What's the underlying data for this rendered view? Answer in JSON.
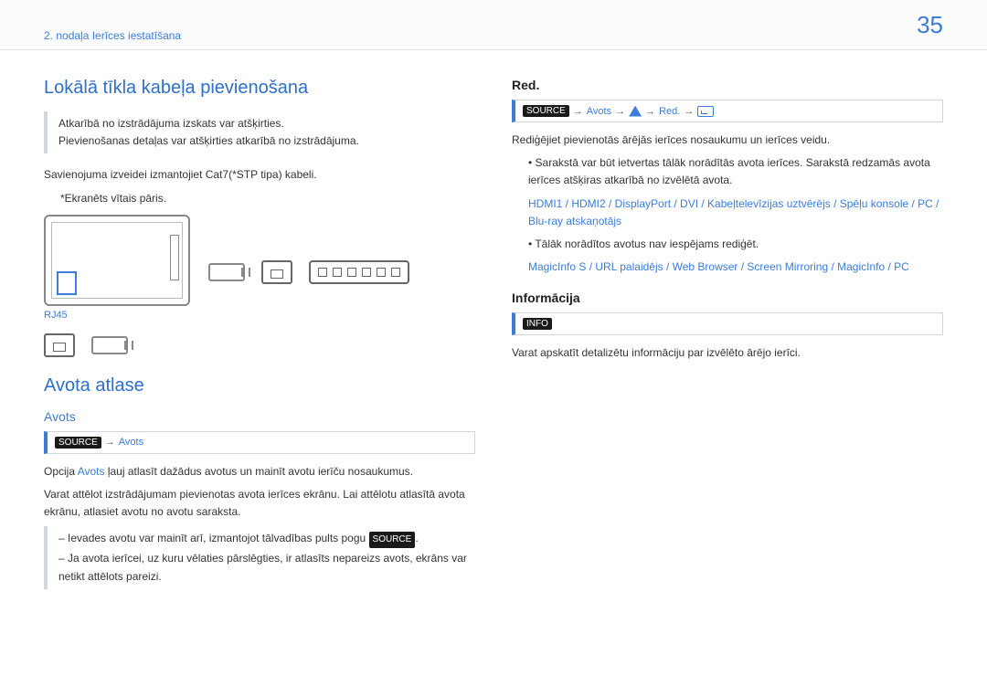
{
  "header": {
    "chapter": "2. nodaļa Ierīces iestatīšana",
    "page_number": "35"
  },
  "left": {
    "h1_cable": "Lokālā tīkla kabeļa pievienošana",
    "note1_line1": "Atkarībā no izstrādājuma izskats var atšķirties.",
    "note1_line2": "Pievienošanas detaļas var atšķirties atkarībā no izstrādājuma.",
    "line_conn": "Savienojuma izveidei izmantojiet Cat7(*STP tipa) kabeli.",
    "line_ekr": "*Ekranēts vītais pāris.",
    "rj45_label": "RJ45",
    "h1_source_sel": "Avota atlase",
    "h2_source": "Avots",
    "path_source": {
      "badge": "SOURCE",
      "text": "Avots"
    },
    "p_opcija_pre": "Opcija ",
    "p_opcija_mid": "Avots",
    "p_opcija_post": " ļauj atlasīt dažādus avotus un mainīt avotu ierīču nosaukumus.",
    "p_varat": "Varat attēlot izstrādājumam pievienotas avota ierīces ekrānu. Lai attēlotu atlasītā avota ekrānu, atlasiet avotu no avotu saraksta.",
    "note2_line1_pre": "Ievades avotu var mainīt arī, izmantojot tālvadības pults pogu ",
    "note2_line1_badge": "SOURCE",
    "note2_line1_post": ".",
    "note2_line2": "Ja avota ierīcei, uz kuru vēlaties pārslēgties, ir atlasīts nepareizs avots, ekrāns var netikt attēlots pareizi."
  },
  "right": {
    "h2_red": "Red.",
    "path_red": {
      "badge": "SOURCE",
      "s1": "Avots",
      "s2": "Red."
    },
    "p_edit": "Rediģējiet pievienotās ārējās ierīces nosaukumu un ierīces veidu.",
    "bullet1": "Sarakstā var būt ietvertas tālāk norādītās avota ierīces. Sarakstā redzamās avota ierīces atšķiras atkarībā no izvēlētā avota.",
    "src_list1": [
      "HDMI1",
      "HDMI2",
      "DisplayPort",
      "DVI",
      "Kabeļtelevīzijas uztvērējs",
      "Spēļu konsole",
      "PC",
      "Blu-ray atskaņotājs"
    ],
    "bullet2": "Tālāk norādītos avotus nav iespējams rediģēt.",
    "src_list2": [
      "MagicInfo S",
      "URL palaidējs",
      "Web Browser",
      "Screen Mirroring",
      "MagicInfo",
      "PC"
    ],
    "h2_info": "Informācija",
    "path_info": {
      "badge": "INFO"
    },
    "p_info": "Varat apskatīt detalizētu informāciju par izvēlēto ārējo ierīci."
  }
}
